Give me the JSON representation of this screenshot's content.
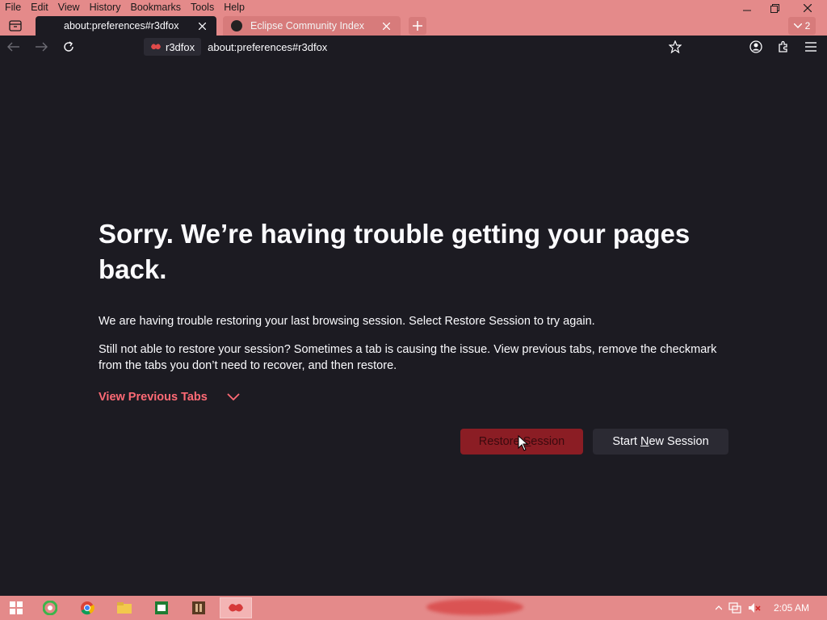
{
  "menu": {
    "items": [
      {
        "label": "File"
      },
      {
        "label": "Edit"
      },
      {
        "label": "View"
      },
      {
        "label": "History"
      },
      {
        "label": "Bookmarks"
      },
      {
        "label": "Tools"
      },
      {
        "label": "Help"
      }
    ]
  },
  "tabs": [
    {
      "title": "about:preferences#r3dfox",
      "active": true
    },
    {
      "title": "Eclipse Community Index",
      "active": false
    }
  ],
  "tab_count": "2",
  "navbar": {
    "identity_label": "r3dfox",
    "url": "about:preferences#r3dfox"
  },
  "page": {
    "title": "Sorry. We’re having trouble getting your pages back.",
    "paragraph1": "We are having trouble restoring your last browsing session. Select Restore Session to try again.",
    "paragraph2": "Still not able to restore your session? Sometimes a tab is causing the issue. View previous tabs, remove the checkmark from the tabs you don’t need to recover, and then restore.",
    "view_previous_tabs": "View Previous Tabs",
    "restore_pre": "Restore ",
    "restore_underlined": "S",
    "restore_post": "ession",
    "new_pre": "Start ",
    "new_underlined": "N",
    "new_post": "ew Session"
  },
  "taskbar": {
    "clock": "2:05 AM"
  },
  "colors": {
    "accent": "#e48a8a",
    "link": "#ff6a75",
    "background": "#1c1b22"
  }
}
